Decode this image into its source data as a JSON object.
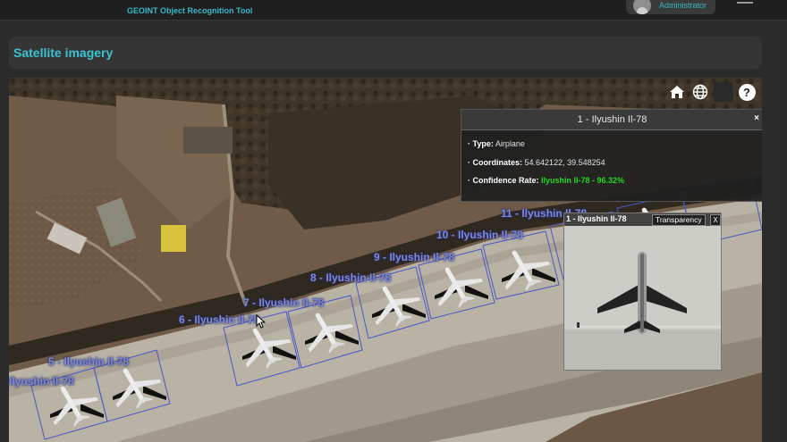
{
  "header": {
    "subtitle": "GEOINT Object Recognition Tool",
    "user_role": "Administrator"
  },
  "panel": {
    "title": "Satellite imagery"
  },
  "map_tools": {
    "help_label": "?"
  },
  "info_popup": {
    "title": "1 - Ilyushin Il-78",
    "close_label": "×",
    "type_label": "· Type:",
    "type_value": "Airplane",
    "coords_label": "· Coordinates:",
    "coords_value": "54.642122, 39.548254",
    "confidence_label": "· Confidence Rate:",
    "confidence_value": "Ilyushin Il-78 - 96.32%"
  },
  "thumbnail": {
    "title": "1 - Ilyushin Il-78",
    "transparency_label": "Transparency",
    "close_label": "X"
  },
  "detections": [
    {
      "label": "11 - Ilyushin Il-78"
    },
    {
      "label": "10 - Ilyushin Il-78"
    },
    {
      "label": "9 - Ilyushin Il-78"
    },
    {
      "label": "8 - Ilyushin Il-78"
    },
    {
      "label": "7 - Ilyushin Il-78"
    },
    {
      "label": "6 - Ilyushin Il-78"
    },
    {
      "label": "5 - Ilyushin Il-78"
    },
    {
      "label": "Ilyushin Il-78"
    }
  ],
  "colors": {
    "accent": "#3cc3d4",
    "detection_box": "#4a56c8",
    "confidence": "#22d822"
  }
}
